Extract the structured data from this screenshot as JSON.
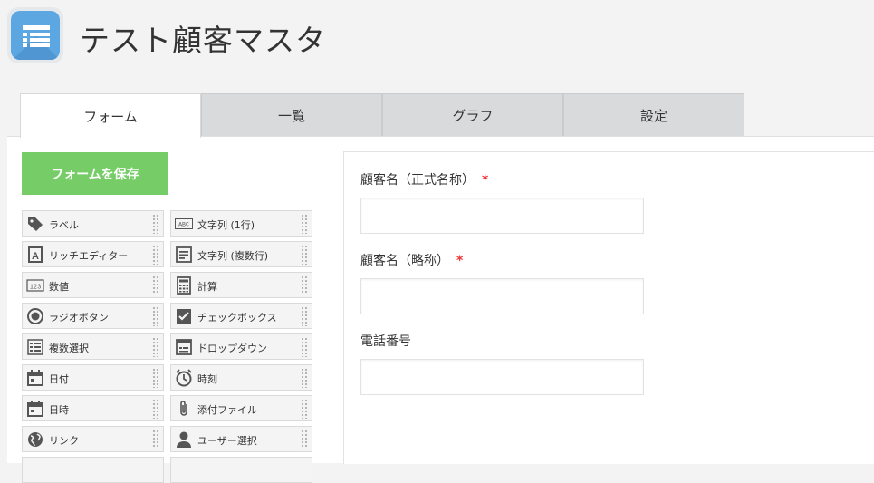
{
  "app": {
    "title": "テスト顧客マスタ",
    "icon": "list-app-icon",
    "icon_color": "#5ca6e2"
  },
  "tabs": [
    {
      "label": "フォーム",
      "active": true
    },
    {
      "label": "一覧",
      "active": false
    },
    {
      "label": "グラフ",
      "active": false
    },
    {
      "label": "設定",
      "active": false
    }
  ],
  "toolbar": {
    "save_label": "フォームを保存",
    "save_color": "#76cd68"
  },
  "palette": {
    "left": [
      {
        "label": "ラベル",
        "icon": "label-tag-icon"
      },
      {
        "label": "リッチエディター",
        "icon": "rich-editor-icon"
      },
      {
        "label": "数値",
        "icon": "number-icon"
      },
      {
        "label": "ラジオボタン",
        "icon": "radio-button-icon"
      },
      {
        "label": "複数選択",
        "icon": "multi-select-icon"
      },
      {
        "label": "日付",
        "icon": "date-icon"
      },
      {
        "label": "日時",
        "icon": "datetime-icon"
      },
      {
        "label": "リンク",
        "icon": "link-globe-icon"
      }
    ],
    "right": [
      {
        "label": "文字列 (1行)",
        "icon": "single-line-text-icon"
      },
      {
        "label": "文字列 (複数行)",
        "icon": "multi-line-text-icon"
      },
      {
        "label": "計算",
        "icon": "calculator-icon"
      },
      {
        "label": "チェックボックス",
        "icon": "checkbox-icon"
      },
      {
        "label": "ドロップダウン",
        "icon": "dropdown-icon"
      },
      {
        "label": "時刻",
        "icon": "clock-icon"
      },
      {
        "label": "添付ファイル",
        "icon": "paperclip-icon"
      },
      {
        "label": "ユーザー選択",
        "icon": "user-icon"
      }
    ]
  },
  "form": {
    "fields": [
      {
        "label": "顧客名（正式名称）",
        "required_mark": "*",
        "value": ""
      },
      {
        "label": "顧客名（略称）",
        "required_mark": "*",
        "value": ""
      },
      {
        "label": "電話番号",
        "required_mark": "",
        "value": ""
      }
    ],
    "required_color": "#e33333"
  }
}
